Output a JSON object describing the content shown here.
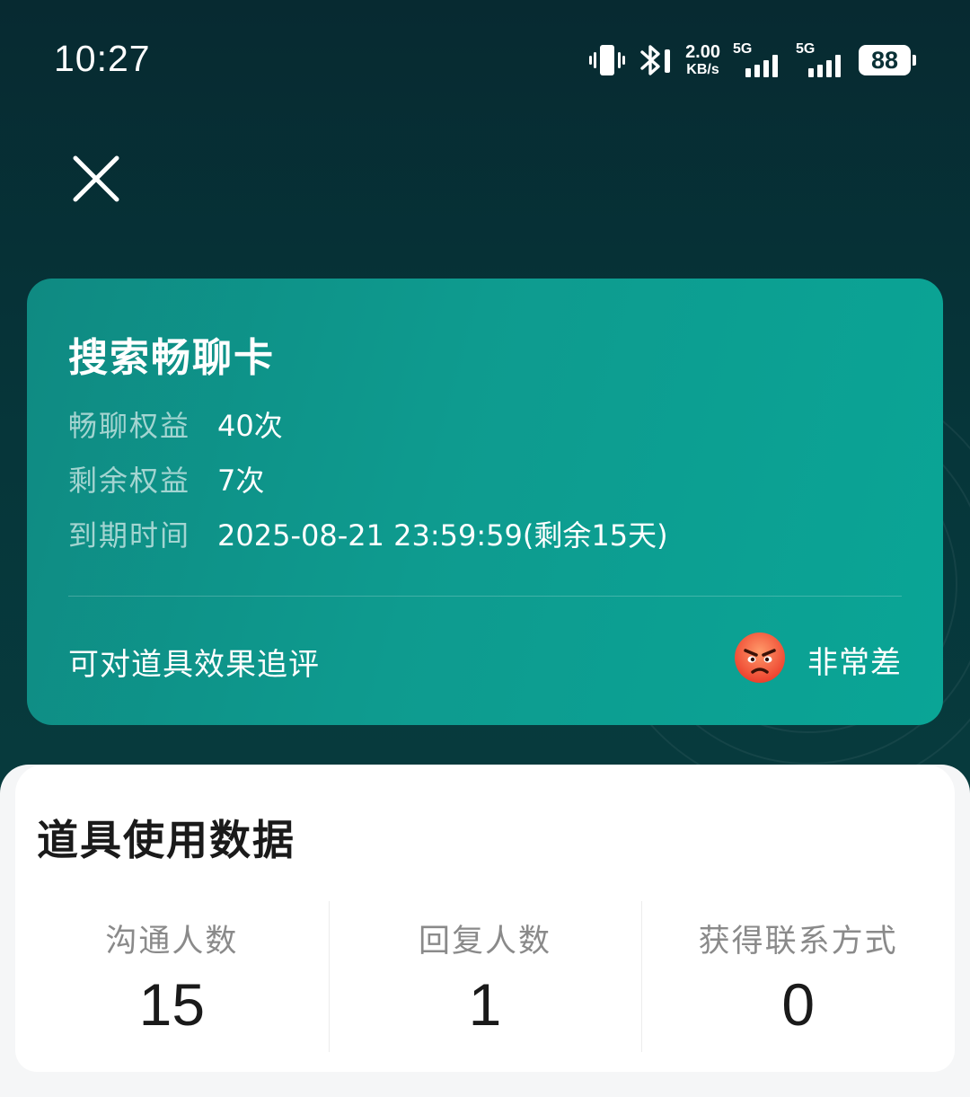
{
  "status_bar": {
    "time": "10:27",
    "net_speed_value": "2.00",
    "net_speed_unit": "KB/s",
    "sim1_type": "5G",
    "sim2_type": "5G",
    "battery_level": "88",
    "icons": [
      "vibrate-icon",
      "bluetooth-icon",
      "signal-icon",
      "signal-icon",
      "battery-icon"
    ]
  },
  "nav": {
    "close_icon": "close-icon"
  },
  "card": {
    "title": "搜索畅聊卡",
    "rows": [
      {
        "label": "畅聊权益",
        "value": "40次"
      },
      {
        "label": "剩余权益",
        "value": "7次"
      },
      {
        "label": "到期时间",
        "value": "2025-08-21 23:59:59(剩余15天)"
      }
    ],
    "review_prompt": "可对道具效果追评",
    "rating": {
      "icon": "angry-face-emoji",
      "label": "非常差"
    }
  },
  "usage": {
    "title": "道具使用数据",
    "stats": [
      {
        "label": "沟通人数",
        "value": "15"
      },
      {
        "label": "回复人数",
        "value": "1"
      },
      {
        "label": "获得联系方式",
        "value": "0"
      }
    ]
  },
  "colors": {
    "background": "#06363a",
    "card_accent": "#0e9b8f",
    "panel_bg": "#ffffff"
  }
}
